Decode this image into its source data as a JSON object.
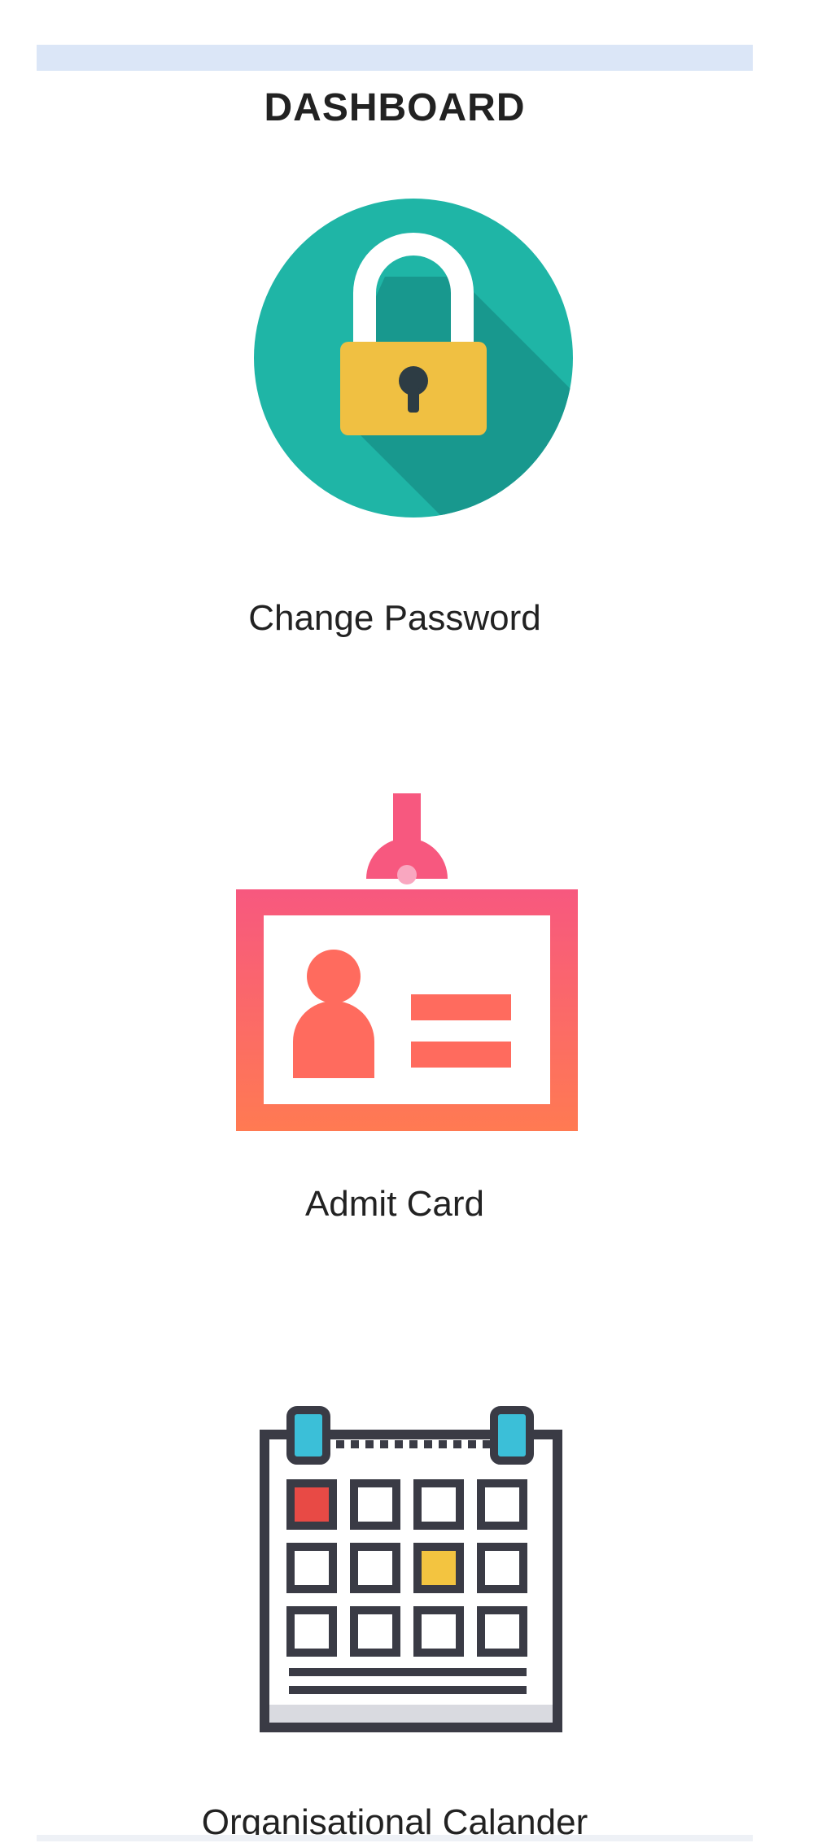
{
  "dashboard": {
    "title": "DASHBOARD"
  },
  "tiles": [
    {
      "label": "Change Password",
      "icon": "padlock-icon"
    },
    {
      "label": "Admit Card",
      "icon": "id-badge-icon"
    },
    {
      "label": "Organisational Calander",
      "icon": "calendar-icon"
    }
  ],
  "colors": {
    "header_bar": "#dbe6f7",
    "padlock_circle": "#1fb5a6",
    "padlock_body": "#f0c042",
    "badge_top": "#f7587f",
    "badge_bottom": "#ff7a52",
    "calendar_frame": "#3a3b45",
    "calendar_marker_red": "#e84a45",
    "calendar_marker_yellow": "#f3c440",
    "calendar_tab_cyan": "#3bbfd8"
  }
}
